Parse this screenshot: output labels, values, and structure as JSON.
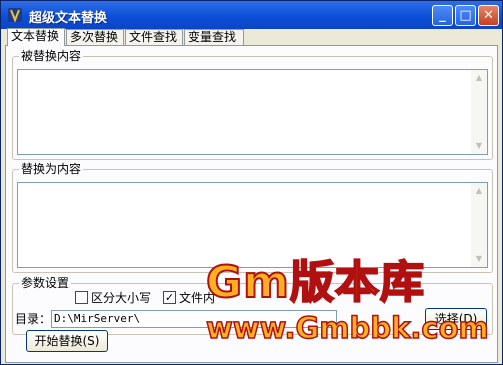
{
  "window": {
    "title": "超级文本替换",
    "buttons": {
      "minimize": "_",
      "maximize": "□",
      "close": "✕"
    }
  },
  "tabs": [
    {
      "label": "文本替换",
      "active": true
    },
    {
      "label": "多次替换",
      "active": false
    },
    {
      "label": "文件查找",
      "active": false
    },
    {
      "label": "变量查找",
      "active": false
    }
  ],
  "find_group": {
    "label": "被替换内容",
    "value": ""
  },
  "replace_group": {
    "label": "替换为内容",
    "value": ""
  },
  "params": {
    "label": "参数设置",
    "case_sensitive": {
      "label": "区分大小写",
      "checked": false
    },
    "file_option": {
      "label": "文件内",
      "checked": true
    },
    "directory_label": "目录：",
    "directory_value": "D:\\MirServer\\",
    "select_button": "选择(D)",
    "start_button": "开始替换(S)"
  },
  "watermark": {
    "line1": "Gm版本库",
    "line2": "www.Gmbbk.com"
  }
}
